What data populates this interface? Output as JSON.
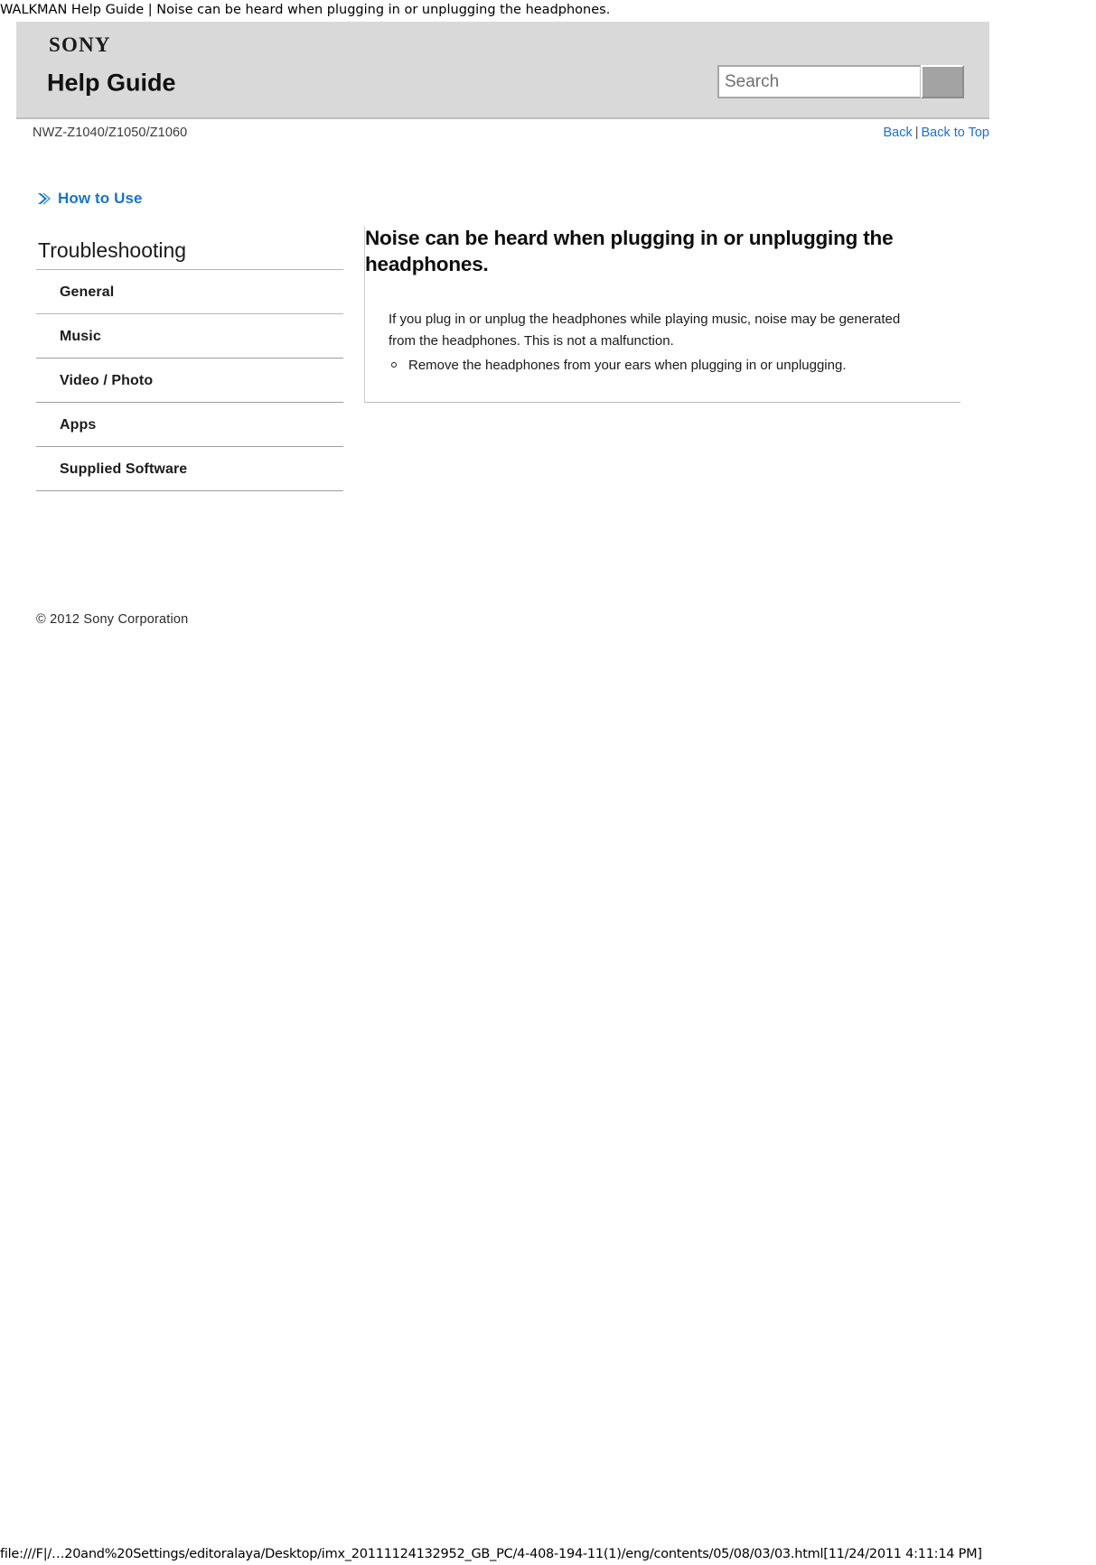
{
  "print_header": {
    "title": "WALKMAN Help Guide | Noise can be heard when plugging in or unplugging the headphones."
  },
  "masthead": {
    "brand": "SONY",
    "title": "Help Guide"
  },
  "search": {
    "value": "",
    "placeholder": "Search",
    "button_label": ""
  },
  "model_row": {
    "model": "NWZ-Z1040/Z1050/Z1060",
    "back_label": "Back",
    "separator": "|",
    "back_to_top_label": "Back to Top"
  },
  "sidebar": {
    "how_to_use_label": "How to Use",
    "section_title": "Troubleshooting",
    "items": [
      {
        "label": "General"
      },
      {
        "label": "Music"
      },
      {
        "label": "Video / Photo"
      },
      {
        "label": "Apps"
      },
      {
        "label": "Supplied Software"
      }
    ],
    "copyright": "© 2012 Sony Corporation"
  },
  "content": {
    "heading": "Noise can be heard when plugging in or unplugging the headphones.",
    "paragraph": "If you plug in or unplug the headphones while playing music, noise may be generated from the headphones. This is not a malfunction.",
    "bullets": [
      {
        "text": "Remove the headphones from your ears when plugging in or unplugging."
      }
    ]
  },
  "status_bar": {
    "path": "file:///F|/…20and%20Settings/editoralaya/Desktop/imx_20111124132952_GB_PC/4-408-194-11(1)/eng/contents/05/08/03/03.html[11/24/2011 4:11:14 PM]"
  },
  "colors": {
    "masthead_bg": "#d9d9d9",
    "link_blue": "#1a6fd4",
    "howto_blue": "#1775c4",
    "rule_gray": "#9e9e9e"
  }
}
